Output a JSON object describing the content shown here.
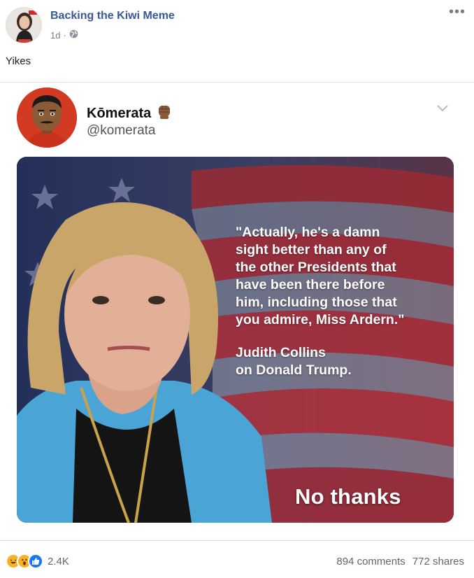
{
  "post": {
    "page_name": "Backing the Kiwi Meme",
    "time": "1d",
    "separator": "·",
    "more_label": "•••",
    "text": "Yikes"
  },
  "tweet": {
    "name": "Kōmerata",
    "handle": "@komerata"
  },
  "meme": {
    "quote": "\"Actually, he's a damn\nsight better than any of\nthe other Presidents that\nhave been there before\nhim, including those that\nyou admire, Miss Ardern.\"",
    "attribution": "Judith Collins\non Donald Trump.",
    "brand": "No thanks"
  },
  "footer": {
    "reaction_count": "2.4K",
    "comments": "894 comments",
    "shares": "772 shares",
    "reaction_icons": [
      "haha-icon",
      "wow-icon",
      "like-icon"
    ]
  },
  "colors": {
    "link": "#385898",
    "meta": "#7a7f87",
    "like_blue": "#1877f2",
    "haha_yellow": "#f7b125",
    "tweet_avatar_red": "#d23b22"
  }
}
